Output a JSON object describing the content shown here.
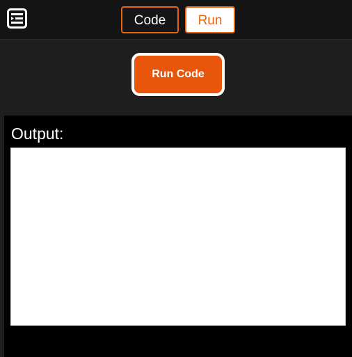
{
  "header": {
    "menu_icon": "sidebar-menu-icon",
    "tabs": [
      {
        "label": "Code",
        "active": false
      },
      {
        "label": "Run",
        "active": true
      }
    ]
  },
  "run_button": {
    "label": "Run Code"
  },
  "output": {
    "label": "Output:",
    "content": ""
  },
  "colors": {
    "accent": "#e8620f",
    "run_button": "#e8560b",
    "topbar": "#141414",
    "background": "#1e1e1e",
    "output_panel": "#000000"
  }
}
